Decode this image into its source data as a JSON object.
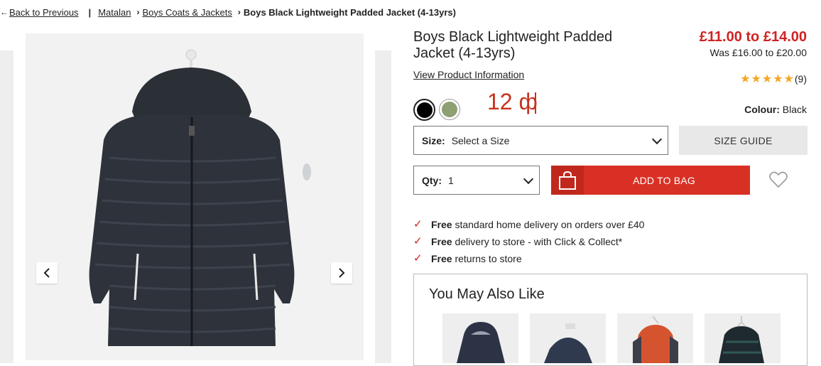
{
  "breadcrumb": {
    "back": "Back to Previous",
    "separator": "|",
    "items": [
      "Matalan",
      "Boys Coats & Jackets"
    ],
    "current": "Boys Black Lightweight Padded Jacket (4-13yrs)"
  },
  "product": {
    "title": "Boys Black Lightweight Padded Jacket (4-13yrs)",
    "view_info": "View Product Information",
    "price": "£11.00 to £14.00",
    "was_price": "Was £16.00 to £20.00",
    "rating_stars": "★★★★★",
    "rating_count": "(9)",
    "overlay_text": "12 ф",
    "colour_label": "Colour:",
    "colour_value": "Black",
    "swatches": [
      "#000000",
      "#8e9f72"
    ]
  },
  "size": {
    "label": "Size:",
    "value": "Select a Size"
  },
  "size_guide": "SIZE GUIDE",
  "qty": {
    "label": "Qty:",
    "value": "1"
  },
  "add_to_bag": "ADD TO BAG",
  "perks": [
    {
      "bold": "Free",
      "text": "standard home delivery on orders over £40"
    },
    {
      "bold": "Free",
      "text": "delivery to store - with Click & Collect*"
    },
    {
      "bold": "Free",
      "text": "returns to store"
    }
  ],
  "also_like": {
    "heading": "You May Also Like"
  },
  "colors": {
    "price_red": "#d12222",
    "button_red": "#d93025",
    "star": "#f5a623"
  }
}
